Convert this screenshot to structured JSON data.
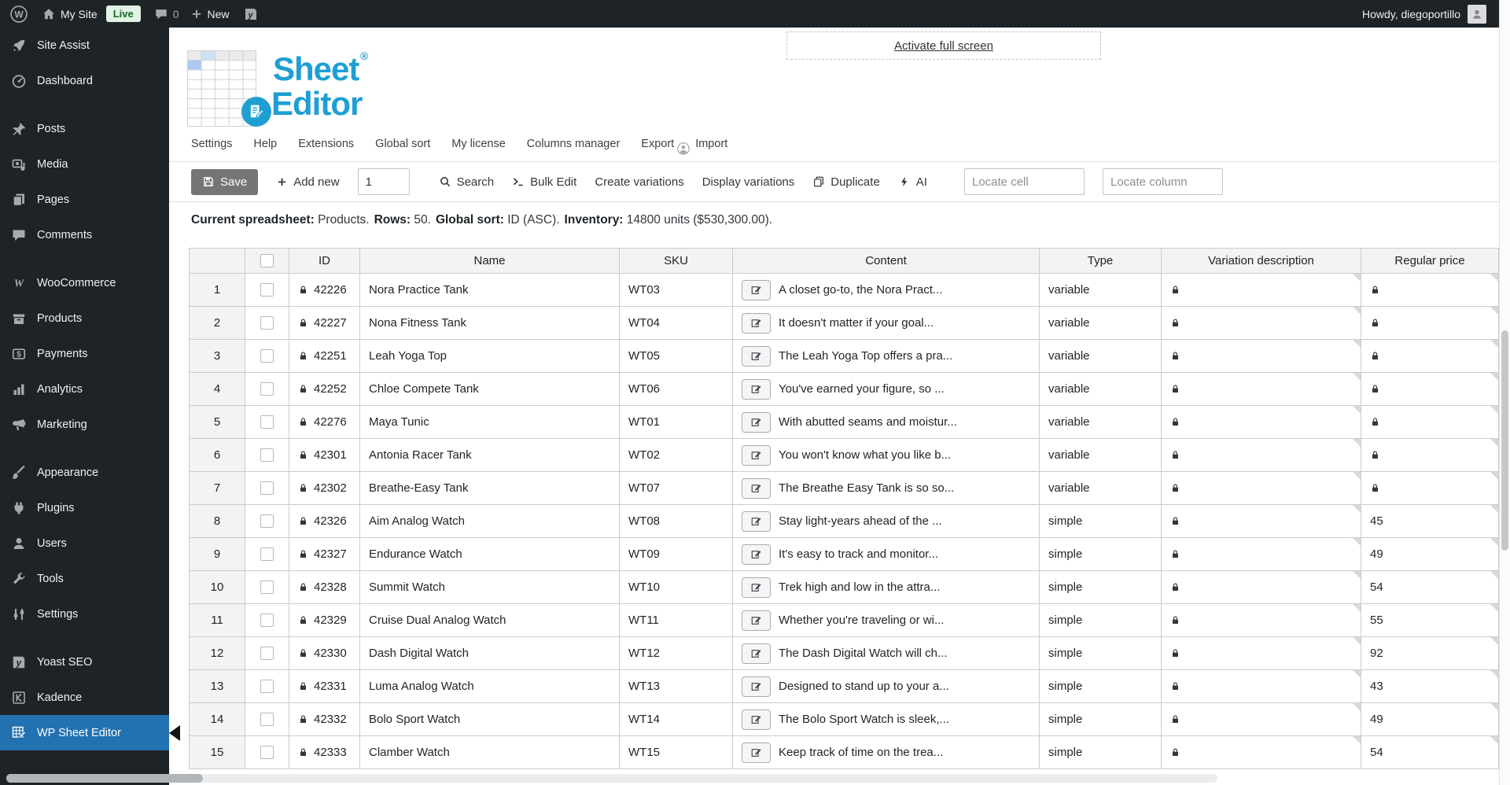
{
  "admin_bar": {
    "site_name": "My Site",
    "live_badge": "Live",
    "comments_count": "0",
    "new_label": "New",
    "howdy": "Howdy, diegoportillo"
  },
  "sidebar": {
    "items": [
      {
        "label": "Site Assist",
        "icon": "rocket",
        "gap": false,
        "active": false
      },
      {
        "label": "Dashboard",
        "icon": "dashboard",
        "gap": false,
        "active": false
      },
      {
        "label": "Posts",
        "icon": "pin",
        "gap": true,
        "active": false
      },
      {
        "label": "Media",
        "icon": "media",
        "gap": false,
        "active": false
      },
      {
        "label": "Pages",
        "icon": "pages",
        "gap": false,
        "active": false
      },
      {
        "label": "Comments",
        "icon": "comments",
        "gap": false,
        "active": false
      },
      {
        "label": "WooCommerce",
        "icon": "woocommerce",
        "gap": true,
        "active": false
      },
      {
        "label": "Products",
        "icon": "products",
        "gap": false,
        "active": false
      },
      {
        "label": "Payments",
        "icon": "payments",
        "gap": false,
        "active": false
      },
      {
        "label": "Analytics",
        "icon": "analytics",
        "gap": false,
        "active": false
      },
      {
        "label": "Marketing",
        "icon": "marketing",
        "gap": false,
        "active": false
      },
      {
        "label": "Appearance",
        "icon": "appearance",
        "gap": true,
        "active": false
      },
      {
        "label": "Plugins",
        "icon": "plugins",
        "gap": false,
        "active": false
      },
      {
        "label": "Users",
        "icon": "users",
        "gap": false,
        "active": false
      },
      {
        "label": "Tools",
        "icon": "tools",
        "gap": false,
        "active": false
      },
      {
        "label": "Settings",
        "icon": "settings",
        "gap": false,
        "active": false
      },
      {
        "label": "Yoast SEO",
        "icon": "yoast",
        "gap": true,
        "active": false
      },
      {
        "label": "Kadence",
        "icon": "kadence",
        "gap": false,
        "active": false
      },
      {
        "label": "WP Sheet Editor",
        "icon": "sheet-editor",
        "gap": false,
        "active": true
      }
    ]
  },
  "header": {
    "fullscreen_link": "Activate full screen",
    "logo": {
      "sheet": "Sheet",
      "editor": "Editor",
      "reg": "®"
    }
  },
  "menu": {
    "items": [
      "Settings",
      "Help",
      "Extensions",
      "Global sort",
      "My license",
      "Columns manager",
      "Export",
      "Import"
    ]
  },
  "toolbar": {
    "save": "Save",
    "add_new": "Add new",
    "rows_input_value": "1",
    "search": "Search",
    "bulk_edit": "Bulk Edit",
    "create_variations": "Create variations",
    "display_variations": "Display variations",
    "duplicate": "Duplicate",
    "ai": "AI",
    "locate_cell_placeholder": "Locate cell",
    "locate_column_placeholder": "Locate column"
  },
  "status": {
    "segments": [
      {
        "label": "Current spreadsheet:",
        "value": "Products."
      },
      {
        "label": "Rows:",
        "value": "50."
      },
      {
        "label": "Global sort:",
        "value": "ID (ASC)."
      },
      {
        "label": "Inventory:",
        "value": "14800 units ($530,300.00)."
      }
    ]
  },
  "table": {
    "columns": {
      "id": "ID",
      "name": "Name",
      "sku": "SKU",
      "content": "Content",
      "type": "Type",
      "variation_description": "Variation description",
      "regular_price": "Regular price"
    },
    "rows": [
      {
        "num": "1",
        "id": "42226",
        "name": "Nora Practice Tank",
        "sku": "WT03",
        "content": "A closet go-to, the Nora Pract...",
        "type": "variable",
        "regular_price": null,
        "price_locked": true
      },
      {
        "num": "2",
        "id": "42227",
        "name": "Nona Fitness Tank",
        "sku": "WT04",
        "content": "It doesn't matter if your goal...",
        "type": "variable",
        "regular_price": null,
        "price_locked": true
      },
      {
        "num": "3",
        "id": "42251",
        "name": "Leah Yoga Top",
        "sku": "WT05",
        "content": "The Leah Yoga Top offers a pra...",
        "type": "variable",
        "regular_price": null,
        "price_locked": true
      },
      {
        "num": "4",
        "id": "42252",
        "name": "Chloe Compete Tank",
        "sku": "WT06",
        "content": "You've earned your figure, so ...",
        "type": "variable",
        "regular_price": null,
        "price_locked": true
      },
      {
        "num": "5",
        "id": "42276",
        "name": "Maya Tunic",
        "sku": "WT01",
        "content": "With abutted seams and moistur...",
        "type": "variable",
        "regular_price": null,
        "price_locked": true
      },
      {
        "num": "6",
        "id": "42301",
        "name": "Antonia Racer Tank",
        "sku": "WT02",
        "content": "You won't know what you like b...",
        "type": "variable",
        "regular_price": null,
        "price_locked": true
      },
      {
        "num": "7",
        "id": "42302",
        "name": "Breathe-Easy Tank",
        "sku": "WT07",
        "content": "The Breathe Easy Tank is so so...",
        "type": "variable",
        "regular_price": null,
        "price_locked": true
      },
      {
        "num": "8",
        "id": "42326",
        "name": "Aim Analog Watch",
        "sku": "WT08",
        "content": "Stay light-years ahead of the ...",
        "type": "simple",
        "regular_price": "45",
        "price_locked": false
      },
      {
        "num": "9",
        "id": "42327",
        "name": "Endurance Watch",
        "sku": "WT09",
        "content": "It's easy to track and monitor...",
        "type": "simple",
        "regular_price": "49",
        "price_locked": false
      },
      {
        "num": "10",
        "id": "42328",
        "name": "Summit Watch",
        "sku": "WT10",
        "content": "Trek high and low in the attra...",
        "type": "simple",
        "regular_price": "54",
        "price_locked": false
      },
      {
        "num": "11",
        "id": "42329",
        "name": "Cruise Dual Analog Watch",
        "sku": "WT11",
        "content": "Whether you're traveling or wi...",
        "type": "simple",
        "regular_price": "55",
        "price_locked": false
      },
      {
        "num": "12",
        "id": "42330",
        "name": "Dash Digital Watch",
        "sku": "WT12",
        "content": "The Dash Digital Watch will ch...",
        "type": "simple",
        "regular_price": "92",
        "price_locked": false
      },
      {
        "num": "13",
        "id": "42331",
        "name": "Luma Analog Watch",
        "sku": "WT13",
        "content": "Designed to stand up to your a...",
        "type": "simple",
        "regular_price": "43",
        "price_locked": false
      },
      {
        "num": "14",
        "id": "42332",
        "name": "Bolo Sport Watch",
        "sku": "WT14",
        "content": "The Bolo Sport Watch is sleek,...",
        "type": "simple",
        "regular_price": "49",
        "price_locked": false
      },
      {
        "num": "15",
        "id": "42333",
        "name": "Clamber Watch",
        "sku": "WT15",
        "content": "Keep track of time on the trea...",
        "type": "simple",
        "regular_price": "54",
        "price_locked": false
      }
    ]
  },
  "icons": {
    "wordpress": "wordpress",
    "home": "home",
    "comment": "comment",
    "plus": "plus",
    "yoast_badge": "yoast-badge",
    "avatar": "avatar",
    "profile": "profile",
    "save": "save",
    "search": "search",
    "terminal": "terminal",
    "duplicate": "duplicate",
    "lightning": "lightning",
    "lock": "lock",
    "edit": "edit",
    "doc_pencil": "doc-pencil"
  },
  "colors": {
    "admin_dark": "#1d2327",
    "accent_blue": "#2271b1",
    "logo_teal": "#1e9fd4",
    "live_green": "#156b24",
    "border_gray": "#cccccc"
  }
}
